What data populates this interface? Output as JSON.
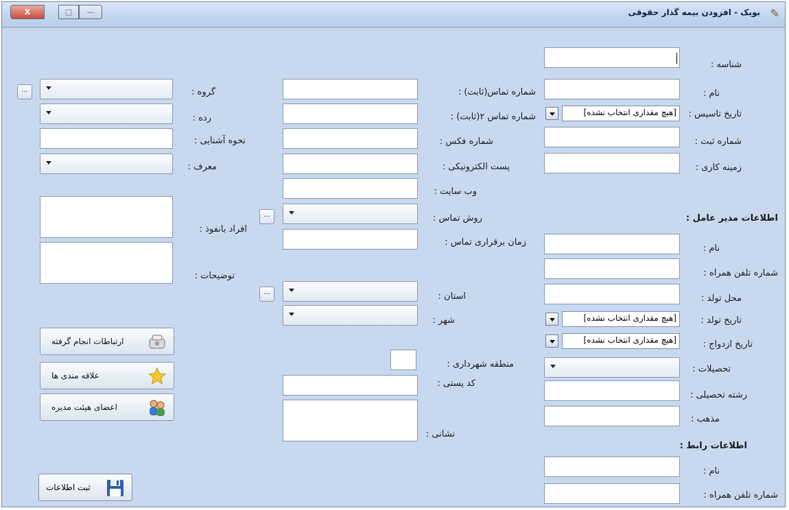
{
  "window": {
    "title": "بویک - افزودن بیمه گذار حقوقی",
    "close_label": "X",
    "max_label": "□",
    "min_label": "—"
  },
  "right_column": {
    "shenaseh": "شناسه :",
    "name": "نام :",
    "tarikh_tasis": "تاریخ تاسیس :",
    "tarikh_tasis_value": "[هیچ مقداری انتخاب نشده]",
    "shomareh_sabt": "شماره ثبت :",
    "zamineh_kari": "زمینه کاری :",
    "manager_section": "اطلاعات مدیر عامل :",
    "manager_name": "نام :",
    "manager_mobile": "شماره تلفن همراه :",
    "manager_birthplace": "محل تولد :",
    "manager_birthdate": "تاریخ تولد :",
    "manager_birthdate_value": "[هیچ مقداری انتخاب نشده]",
    "manager_marriage": "تاریخ ازدواج :",
    "manager_marriage_value": "[هیچ مقداری انتخاب نشده]",
    "manager_education": "تحصیلات :",
    "manager_field": "رشته تحصیلی :",
    "manager_religion": "مذهب :",
    "link_section": "اطلاعات رابط :",
    "link_name": "نام :",
    "link_mobile": "شماره تلفن همراه :"
  },
  "middle_column": {
    "phone1": "شماره تماس(ثابت) :",
    "phone2": "شماره تماس ۲(ثابت) :",
    "fax": "شماره فکس :",
    "email": "پست الکترونیکی :",
    "website": "وب سایت :",
    "contact_method": "روش تماس :",
    "contact_time": "زمان برقراری تماس :",
    "province": "استان :",
    "city": "شهر :",
    "municipality": "منطقه شهرداری :",
    "postal_code": "کد پستی :",
    "address": "نشانی :"
  },
  "left_column": {
    "group": "گروه :",
    "rank": "رده :",
    "acquaintance": "نحوه آشنایی :",
    "referrer": "معرف :",
    "influential": "افراد بانفوذ :",
    "description": "توضیحات :",
    "btn_communications": "ارتباطات انجام گرفته",
    "btn_interests": "علاقه مندی ها",
    "btn_board": "اعضای هیئت مدیره",
    "btn_save": "ثبت اطلاعات"
  },
  "dots_label": "...",
  "colors": {
    "background": "#c8d9ef",
    "titlebar": "#c5d7ef",
    "close_button": "#c94e3a"
  }
}
